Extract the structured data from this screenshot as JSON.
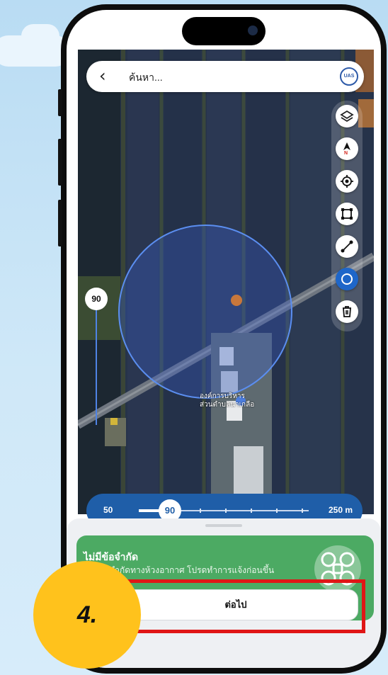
{
  "search": {
    "placeholder": "ค้นหา...",
    "badge": "UAS"
  },
  "map": {
    "marker_label": "90",
    "place_label_line1": "องค์การบริหาร",
    "place_label_line2": "ส่วนตำบลนาเกลือ"
  },
  "toolbar": {
    "items": [
      {
        "name": "layers",
        "icon": "layers-icon"
      },
      {
        "name": "compass",
        "icon": "compass-icon",
        "label": "N"
      },
      {
        "name": "locate",
        "icon": "locate-icon"
      },
      {
        "name": "polygon",
        "icon": "polygon-icon"
      },
      {
        "name": "line",
        "icon": "line-icon"
      },
      {
        "name": "circle",
        "icon": "circle-icon",
        "active": true
      },
      {
        "name": "delete",
        "icon": "trash-icon"
      }
    ]
  },
  "radius_slider": {
    "min_label": "50",
    "max_label": "250 m",
    "value": 90,
    "min": 50,
    "max": 250
  },
  "notice": {
    "title": "ไม่มีข้อจำกัด",
    "body": "ไม่มีข้อจำกัดทางห้วงอากาศ โปรดทำการแจ้งก่อนขึ้น",
    "icon": "drone-icon"
  },
  "next_button": {
    "label": "ต่อไป"
  },
  "step_badge": {
    "label": "4."
  },
  "colors": {
    "accent": "#1f5ea8",
    "circle": "#4a80e8",
    "notice_green": "#4caa63",
    "highlight_red": "#e01616",
    "badge_yellow": "#ffc21c"
  }
}
